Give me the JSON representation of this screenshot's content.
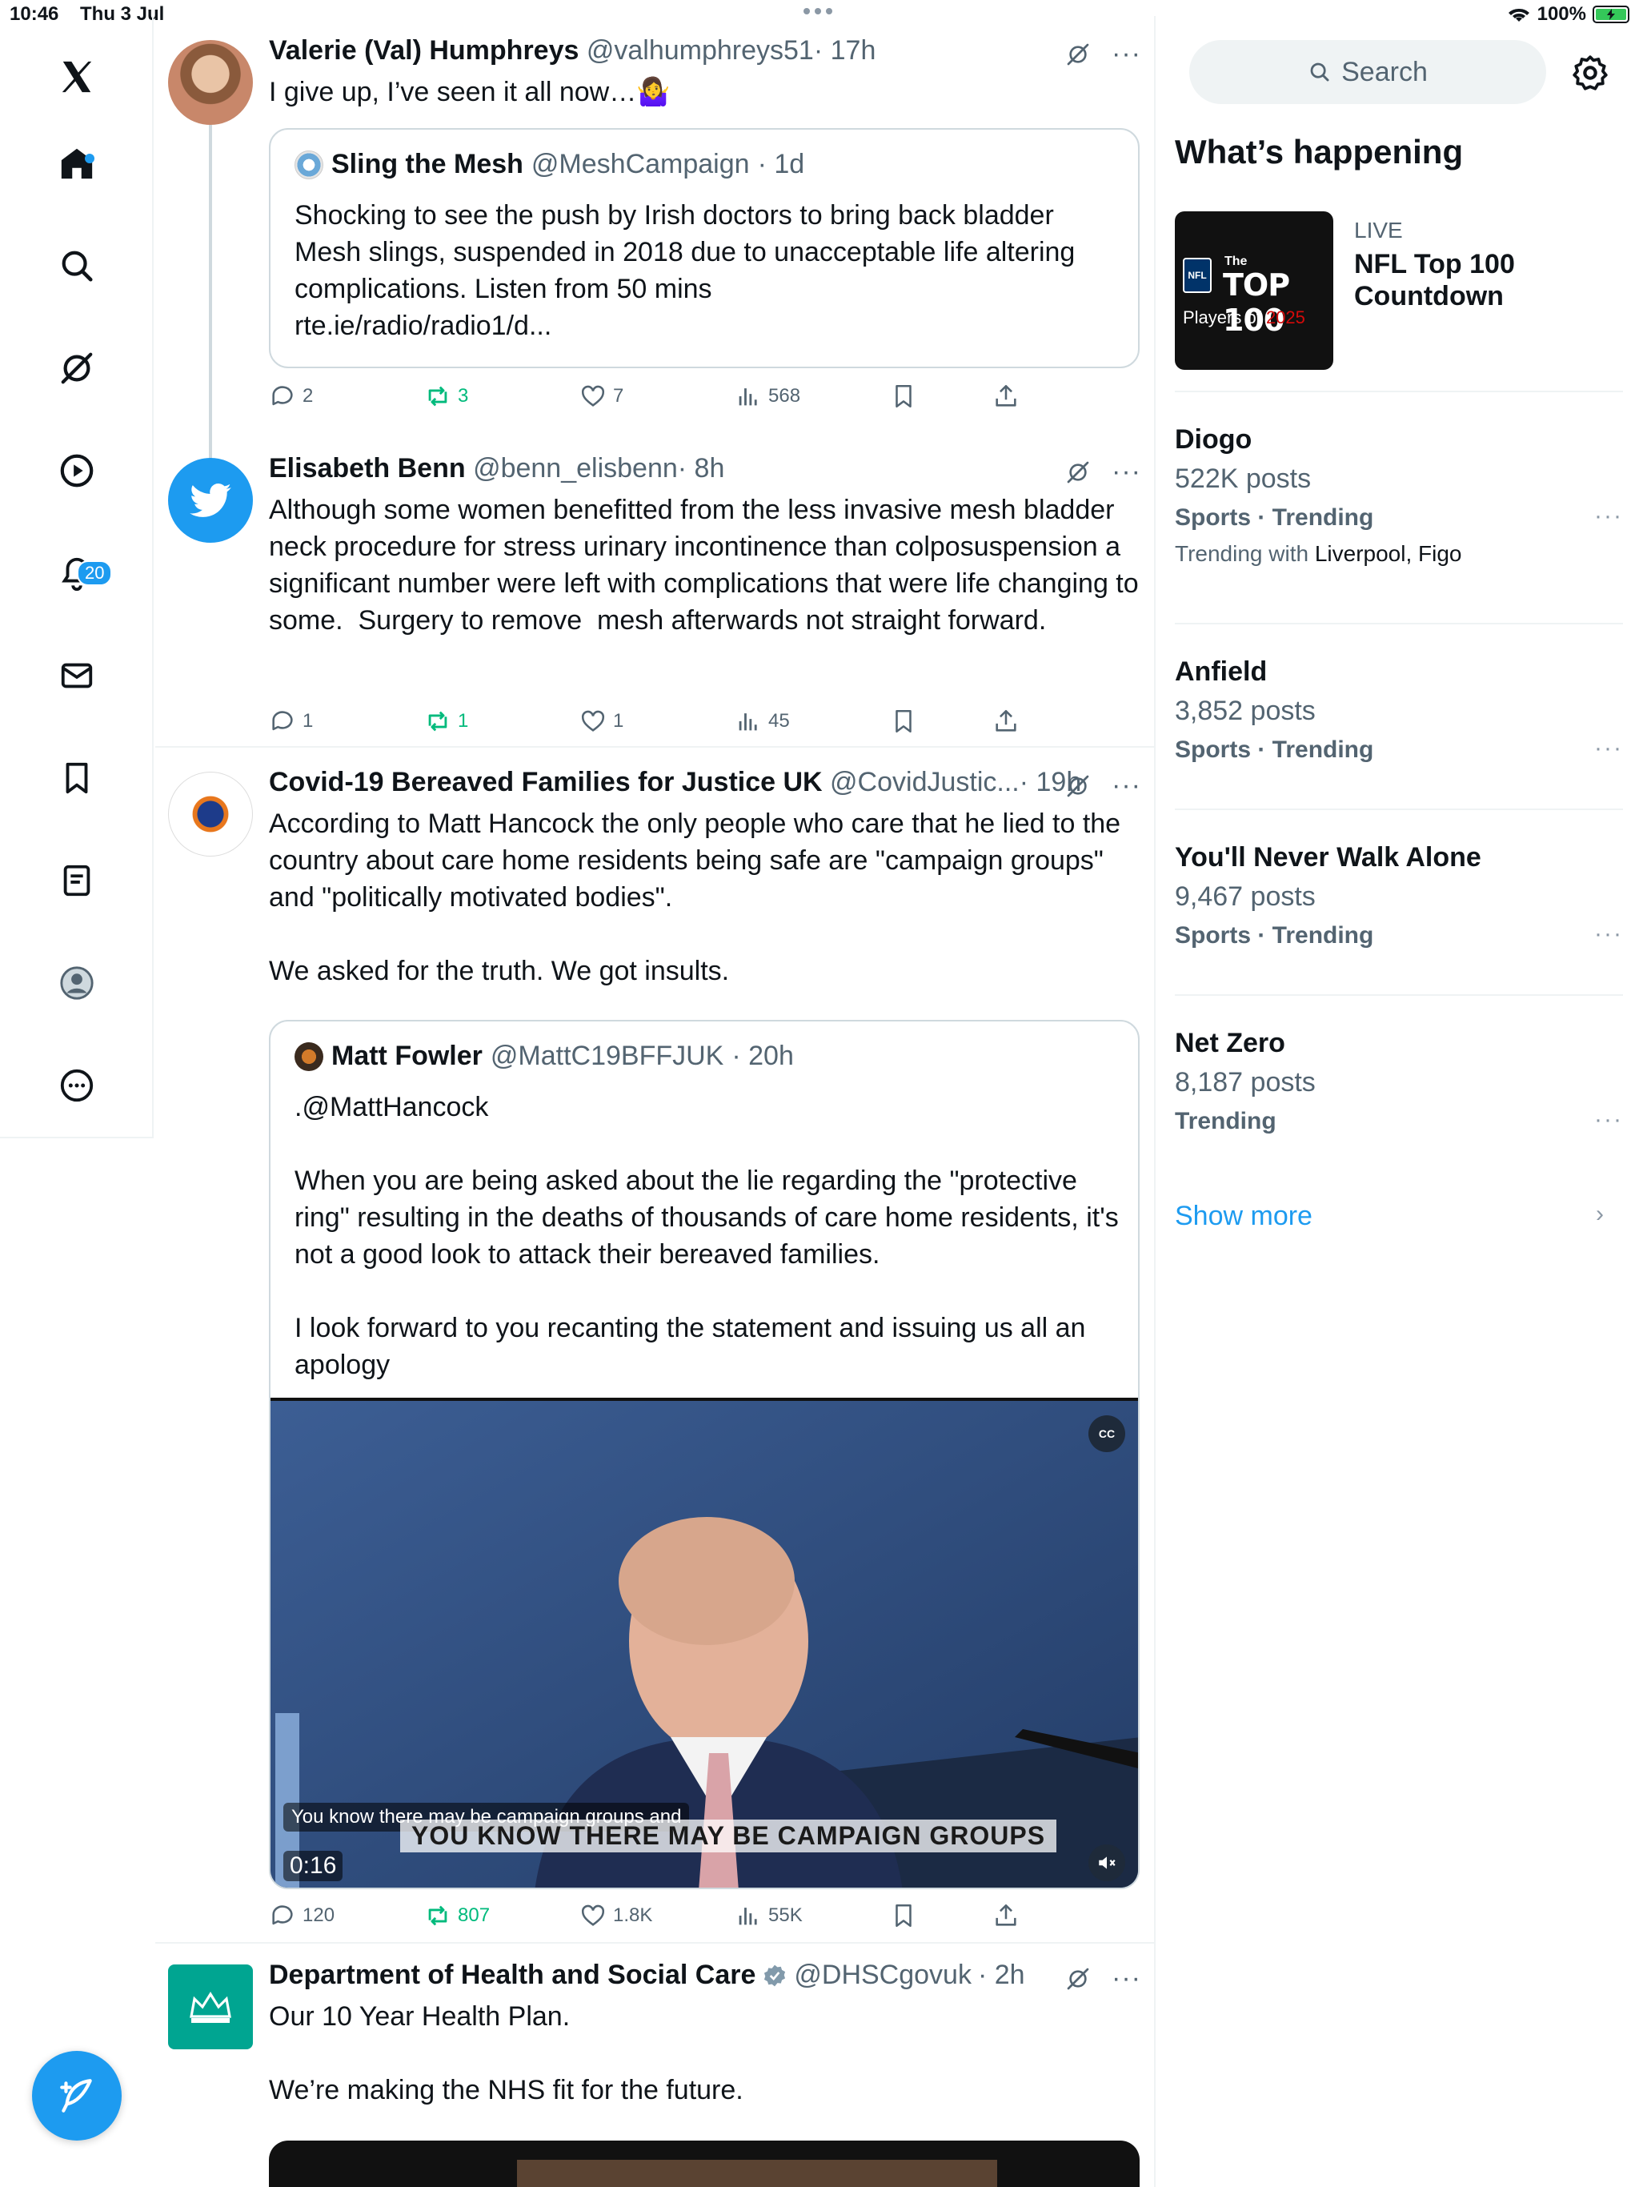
{
  "status_bar": {
    "time": "10:46",
    "date": "Thu 3 Jul",
    "battery": "100%"
  },
  "nav": {
    "notifications_count": "20"
  },
  "tweets": [
    {
      "name": "Valerie (Val) Humphreys",
      "handle": "@valhumphreys51",
      "time": "· 17h",
      "text": "I give up, I’ve seen it all now…🤷‍♀️",
      "quote": {
        "name": "Sling the Mesh",
        "handle": "@MeshCampaign",
        "time": "· 1d",
        "text": "Shocking to see the push by Irish doctors to bring back bladder Mesh slings, suspended in 2018 due to unacceptable life altering complications. Listen from 50 mins\nrte.ie/radio/radio1/d..."
      },
      "replies": "2",
      "reposts": "3",
      "likes": "7",
      "views": "568"
    },
    {
      "name": "Elisabeth Benn",
      "handle": "@benn_elisbenn",
      "time": "· 8h",
      "text": "Although some women benefitted from the less invasive mesh bladder neck procedure for stress urinary incontinence than colposuspension a significant number were left with complications that were life changing to some.  Surgery to remove  mesh afterwards not straight forward.",
      "replies": "1",
      "reposts": "1",
      "likes": "1",
      "views": "45"
    },
    {
      "name": "Covid-19 Bereaved Families for Justice UK",
      "handle": "@CovidJustic...",
      "time": "· 19h",
      "text": "According to Matt Hancock the only people who care that he lied to the country about care home residents being safe are \"campaign groups\" and \"politically motivated bodies\".\n\nWe asked for the truth. We got insults.",
      "quote": {
        "name": "Matt Fowler",
        "handle": "@MattC19BFFJUK",
        "time": "· 20h",
        "text": ".@MattHancock\n\nWhen you are being asked about the lie regarding the \"protective ring\" resulting in the deaths of thousands of care home residents, it's not a good look to attack their bereaved families.\n\nI look forward to you recanting the statement and issuing us all an apology"
      },
      "video": {
        "caption_small": "You know there may be campaign groups and",
        "caption_big": "YOU KNOW THERE MAY BE CAMPAIGN GROUPS",
        "duration": "0:16",
        "cc": "CC"
      },
      "replies": "120",
      "reposts": "807",
      "likes": "1.8K",
      "views": "55K"
    },
    {
      "name": "Department of Health and Social Care",
      "handle": "@DHSCgovuk",
      "time": "· 2h",
      "text": "Our 10 Year Health Plan.\n\nWe’re making the NHS fit for the future."
    }
  ],
  "sidebar": {
    "search_placeholder": "Search",
    "title": "What’s happening",
    "live": {
      "label": "LIVE",
      "title": "NFL Top 100 Countdown",
      "img_the": "The",
      "img_top": "TOP 100",
      "img_players": "Players of",
      "img_year": "2025",
      "img_nfl": "NFL"
    },
    "trends": [
      {
        "name": "Diogo",
        "posts": "522K posts",
        "category": "Sports · Trending",
        "with_label": "Trending with",
        "with": "Liverpool, Figo"
      },
      {
        "name": "Anfield",
        "posts": "3,852 posts",
        "category": "Sports · Trending"
      },
      {
        "name": "You'll Never Walk Alone",
        "posts": "9,467 posts",
        "category": "Sports · Trending"
      },
      {
        "name": "Net Zero",
        "posts": "8,187 posts",
        "category": "Trending"
      }
    ],
    "show_more": "Show more"
  },
  "colors": {
    "accent": "#1d9bf0",
    "repost_green": "#00ba7c",
    "secondary_text": "#536471"
  }
}
